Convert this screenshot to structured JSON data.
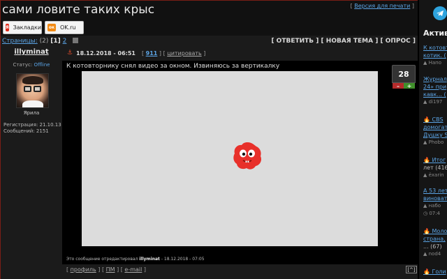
{
  "thread": {
    "title": "сами ловите таких крыс",
    "print_link": "Версия для печати"
  },
  "share": {
    "bookmarks_label": "Закладки",
    "bookmarks_icon": "ya-icon",
    "ok_label": "OK.ru",
    "ok_icon": "ok-icon"
  },
  "pages": {
    "label": "Страницы:",
    "total": "(2)",
    "current": "[1]",
    "next": "2"
  },
  "actions": {
    "reply": "[ ОТВЕТИТЬ ]",
    "new_topic": "[ НОВАЯ ТЕМА ]",
    "poll": "[ ОПРОС ]"
  },
  "user": {
    "name": "illyminat",
    "status_label": "Статус:",
    "status_value": "Offline",
    "avatar_caption": "Ярила",
    "registration": "Регистрация: 21.10.13",
    "messages": "Сообщений: 2151"
  },
  "post": {
    "date": "18.12.2018 - 06:51",
    "number": "911",
    "quote_label": "цитировать",
    "text": "К котовторнику снял видео за окном. Извиняюсь за вертикалку",
    "rating": "28",
    "rating_minus": "–",
    "rating_plus": "+",
    "edited_prefix": "Это сообщение отредактировал",
    "edited_by": "illyminat",
    "edited_suffix": "- 18.12.2018 - 07:05",
    "profile_label": "профиль",
    "pm_label": "ПМ",
    "email_label": "e-mail",
    "up_label": "[^]"
  },
  "sidebar": {
    "heading": "Активн",
    "items": [
      {
        "title": "К котовт",
        "count": "котик. (",
        "author": "Напо"
      },
      {
        "title": "Журнал",
        "count": "24» при",
        "author": "di197",
        "extra": "кавк... ("
      },
      {
        "title": "CBS",
        "count": "домогат",
        "author": "Phobo",
        "extra": "Душку S",
        "hot": true
      },
      {
        "title": "Итог",
        "count": "лет (416",
        "author": "ёxarin",
        "hot": true
      },
      {
        "title": "А 53 лет",
        "count": "виноват",
        "author": "набо",
        "extra2": "07:4"
      },
      {
        "title": "Моло",
        "count": "страна,",
        "author": "nod4",
        "extra": "... (67)",
        "hot": true
      },
      {
        "title": "Голи",
        "hot": true
      }
    ]
  },
  "colors": {
    "link": "#5ba4e5",
    "accent_border": "#7a1e16",
    "rating_minus": "#b52b2b",
    "rating_plus": "#3f8f2a",
    "telegram": "#2ea3dd"
  }
}
